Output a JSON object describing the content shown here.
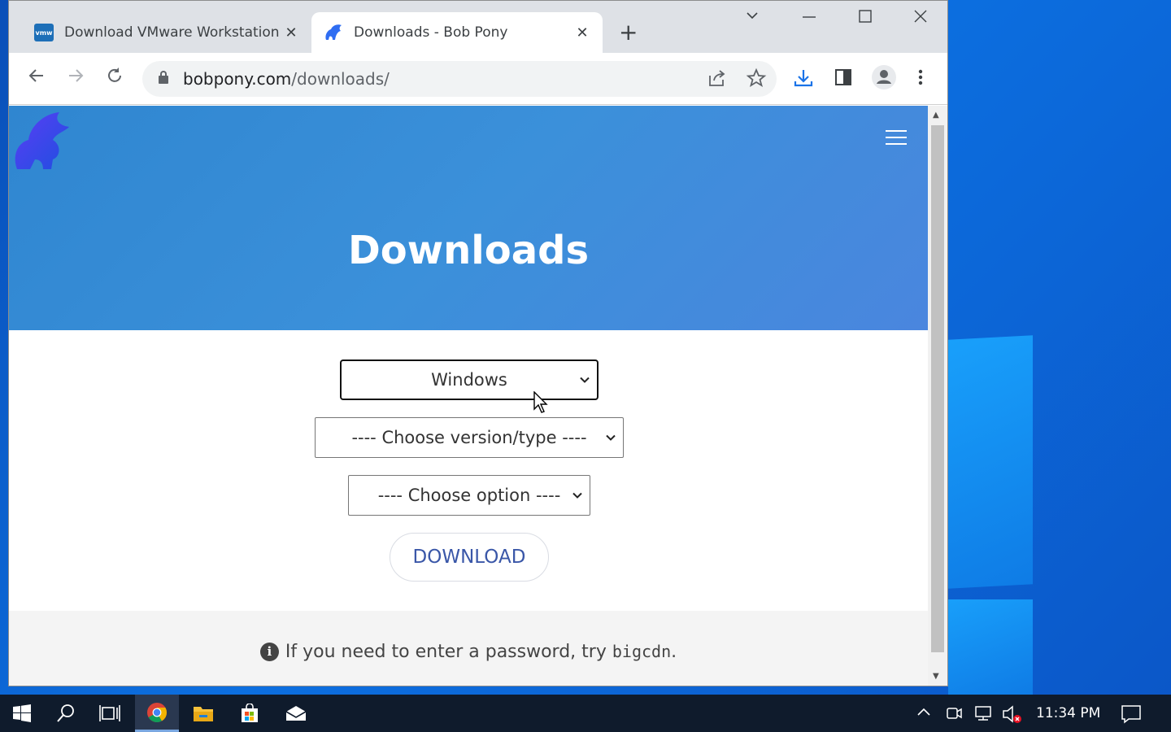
{
  "browser": {
    "tabs": [
      {
        "title": "Download VMware Workstation",
        "favicon": "vmw",
        "active": false
      },
      {
        "title": "Downloads - Bob Pony",
        "favicon": "bobpony-logo",
        "active": true
      }
    ],
    "new_tab_symbol": "+",
    "close_symbol": "✕",
    "url_host": "bobpony.com",
    "url_path": "/downloads/"
  },
  "page": {
    "title": "Downloads",
    "os_select": {
      "value": "Windows"
    },
    "version_select": {
      "value": "---- Choose version/type ----"
    },
    "option_select": {
      "value": "---- Choose option ----"
    },
    "download_button": "DOWNLOAD",
    "note_prefix": "If you need to enter a password, try ",
    "note_code": "bigcdn",
    "note_suffix": ".",
    "info_symbol": "i"
  },
  "taskbar": {
    "clock": "11:34 PM",
    "items": [
      "windows-start-icon",
      "search-icon",
      "task-view-icon",
      "chrome-icon",
      "file-explorer-icon",
      "store-icon",
      "mail-icon"
    ]
  },
  "colors": {
    "hero_start": "#2f86d0",
    "hero_end": "#4a86de",
    "download_text": "#3a57a8",
    "taskbar": "#0f1b2c"
  }
}
